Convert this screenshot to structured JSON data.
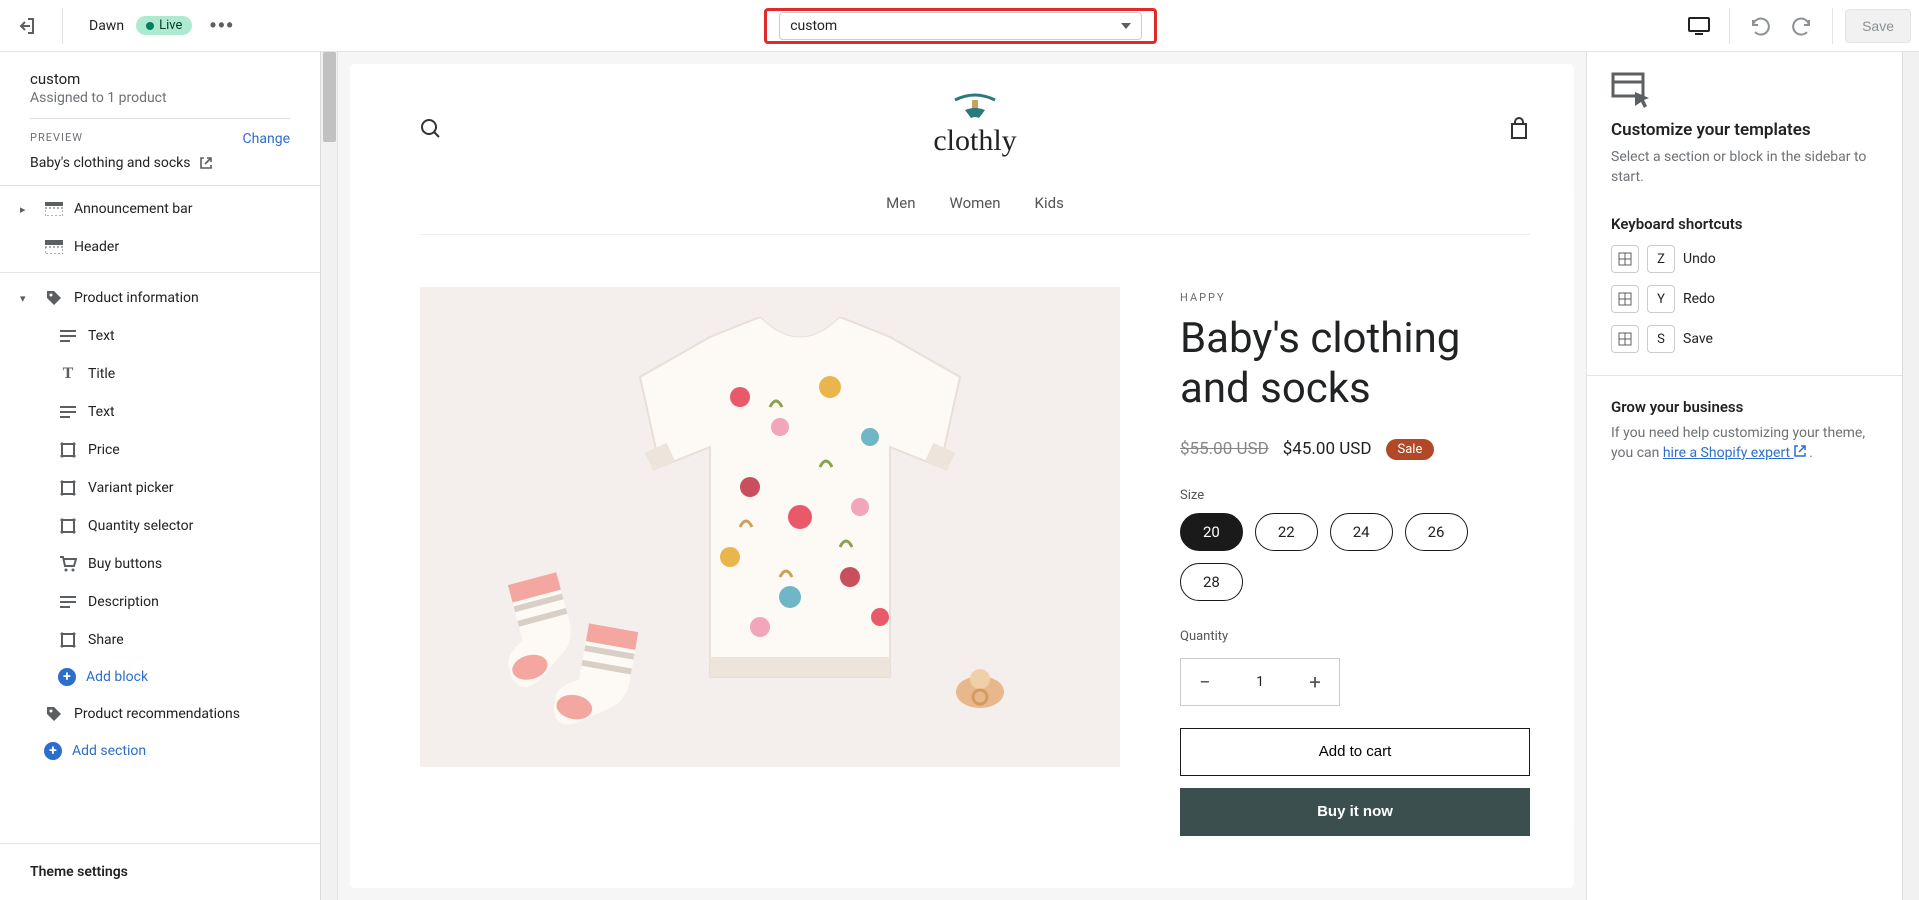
{
  "topbar": {
    "theme_name": "Dawn",
    "live_label": "Live",
    "template_selected": "custom",
    "save_label": "Save"
  },
  "left": {
    "title": "custom",
    "subtitle": "Assigned to 1 product",
    "preview_label": "PREVIEW",
    "change_label": "Change",
    "preview_product": "Baby's clothing and socks",
    "items": {
      "announcement": "Announcement bar",
      "header": "Header",
      "product_info": "Product information",
      "text1": "Text",
      "title": "Title",
      "text2": "Text",
      "price": "Price",
      "variant_picker": "Variant picker",
      "quantity_selector": "Quantity selector",
      "buy_buttons": "Buy buttons",
      "description": "Description",
      "share": "Share",
      "add_block": "Add block",
      "product_recs": "Product recommendations",
      "add_section": "Add section"
    },
    "theme_settings": "Theme settings"
  },
  "store": {
    "logo_text": "clothly",
    "nav": {
      "men": "Men",
      "women": "Women",
      "kids": "Kids"
    },
    "vendor": "HAPPY",
    "product_title": "Baby's clothing and socks",
    "old_price": "$55.00 USD",
    "price": "$45.00 USD",
    "sale": "Sale",
    "size_label": "Size",
    "sizes": [
      "20",
      "22",
      "24",
      "26",
      "28"
    ],
    "qty_label": "Quantity",
    "qty_value": "1",
    "add_to_cart": "Add to cart",
    "buy_now": "Buy it now"
  },
  "right": {
    "customize_h": "Customize your templates",
    "customize_p": "Select a section or block in the sidebar to start.",
    "shortcuts_h": "Keyboard shortcuts",
    "undo": "Undo",
    "redo": "Redo",
    "save": "Save",
    "key_z": "Z",
    "key_y": "Y",
    "key_s": "S",
    "grow_h": "Grow your business",
    "grow_p1": "If you need help customizing your theme, you can ",
    "grow_link": "hire a Shopify expert",
    "grow_p2": " ."
  }
}
